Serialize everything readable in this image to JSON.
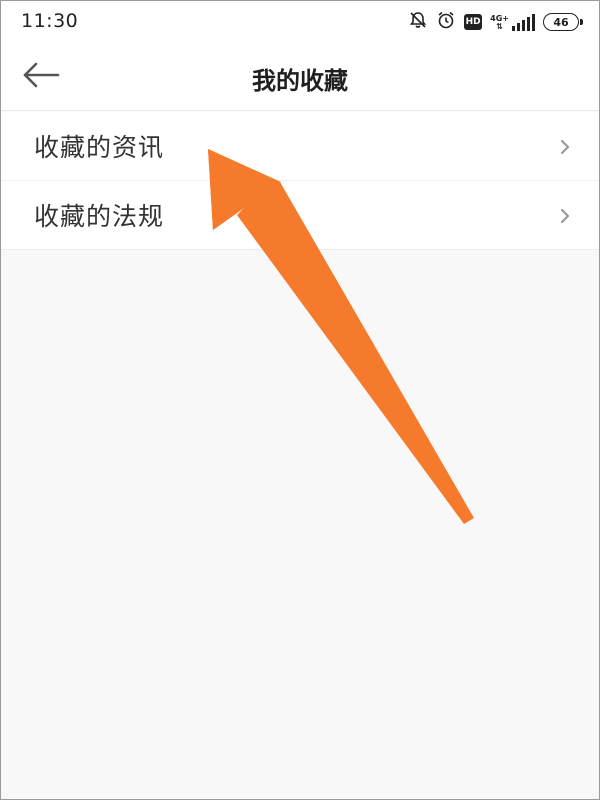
{
  "status_bar": {
    "time": "11:30",
    "network": "4G+",
    "hd": "HD",
    "battery": "46",
    "icons": [
      "mute-icon",
      "alarm-icon",
      "hd-icon",
      "signal-icon",
      "battery-icon"
    ]
  },
  "header": {
    "title": "我的收藏",
    "back_icon": "back-arrow-icon"
  },
  "list": {
    "items": [
      {
        "label": "收藏的资讯",
        "icon": "chevron-right-icon"
      },
      {
        "label": "收藏的法规",
        "icon": "chevron-right-icon"
      }
    ]
  },
  "annotation": {
    "icon": "orange-arrow-icon",
    "color": "#f57a2b"
  },
  "colors": {
    "background": "#f8f8f8",
    "surface": "#ffffff",
    "text_primary": "#1f1f1f",
    "text_secondary": "#333333",
    "chevron": "#999999",
    "arrow": "#f57a2b"
  }
}
